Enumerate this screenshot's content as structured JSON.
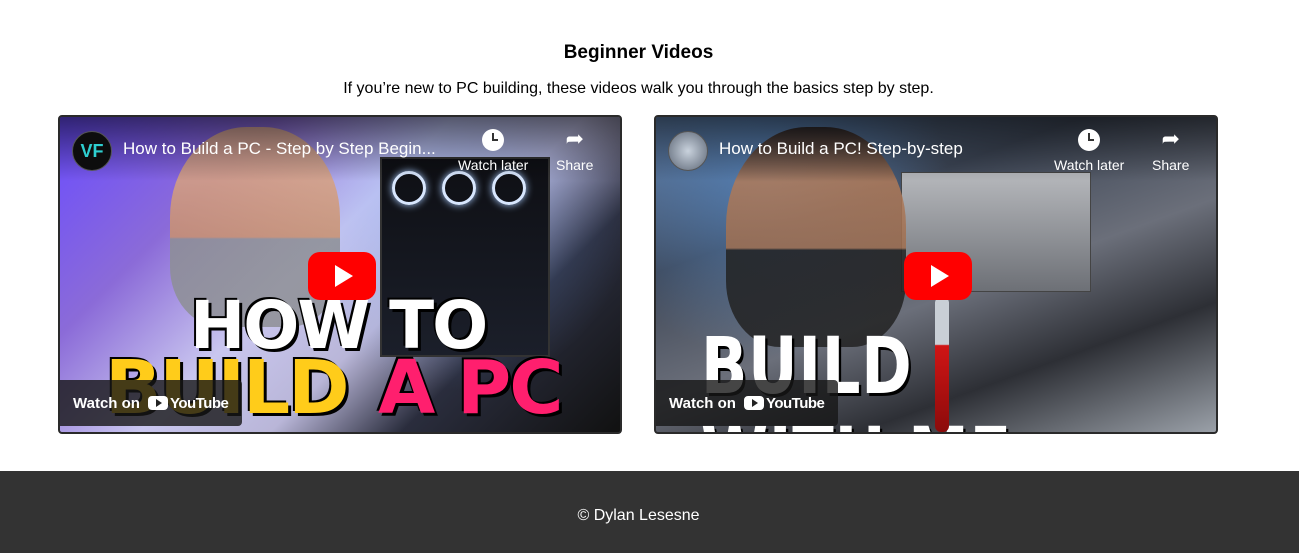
{
  "section": {
    "title": "Beginner Videos",
    "description": "If you’re new to PC building, these videos walk you through the basics step by step."
  },
  "videos": [
    {
      "title": "How to Build a PC - Step by Step Begin...",
      "channel_avatar_text": "VF",
      "watch_later_label": "Watch later",
      "share_label": "Share",
      "watch_on_label": "Watch on",
      "youtube_label": "YouTube",
      "thumbnail_text": [
        "HOW TO",
        "BUILD",
        "A PC"
      ]
    },
    {
      "title": "How to Build a PC! Step-by-step",
      "channel_avatar_text": "",
      "watch_later_label": "Watch later",
      "share_label": "Share",
      "watch_on_label": "Watch on",
      "youtube_label": "YouTube",
      "thumbnail_text": [
        "BUILD WITH ME"
      ]
    }
  ],
  "footer": {
    "copyright": "© Dylan Lesesne"
  },
  "colors": {
    "footer_bg": "#333333",
    "youtube_red": "#ff0000",
    "page_bg": "#ffffff"
  }
}
